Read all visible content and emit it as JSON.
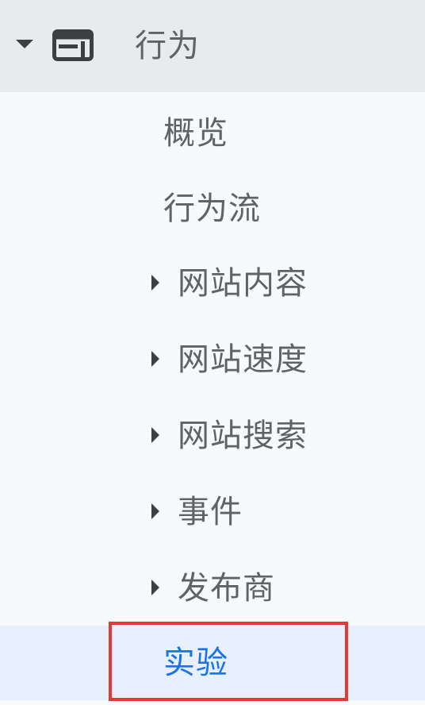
{
  "section": {
    "label": "行为",
    "icon": "dashboard-layout-icon",
    "caret_icon": "caret-down-icon",
    "expanded": true
  },
  "items": [
    {
      "label": "概览",
      "expandable": false,
      "active": false
    },
    {
      "label": "行为流",
      "expandable": false,
      "active": false
    },
    {
      "label": "网站内容",
      "expandable": true,
      "active": false
    },
    {
      "label": "网站速度",
      "expandable": true,
      "active": false
    },
    {
      "label": "网站搜索",
      "expandable": true,
      "active": false
    },
    {
      "label": "事件",
      "expandable": true,
      "active": false
    },
    {
      "label": "发布商",
      "expandable": true,
      "active": false
    },
    {
      "label": "实验",
      "expandable": false,
      "active": true
    }
  ],
  "colors": {
    "background": "#f8f9fa",
    "header_background": "#e8eaed",
    "text": "#5f6368",
    "active_text": "#1a73e8",
    "active_background": "#e8f0fe",
    "highlight_border": "#e53935"
  }
}
